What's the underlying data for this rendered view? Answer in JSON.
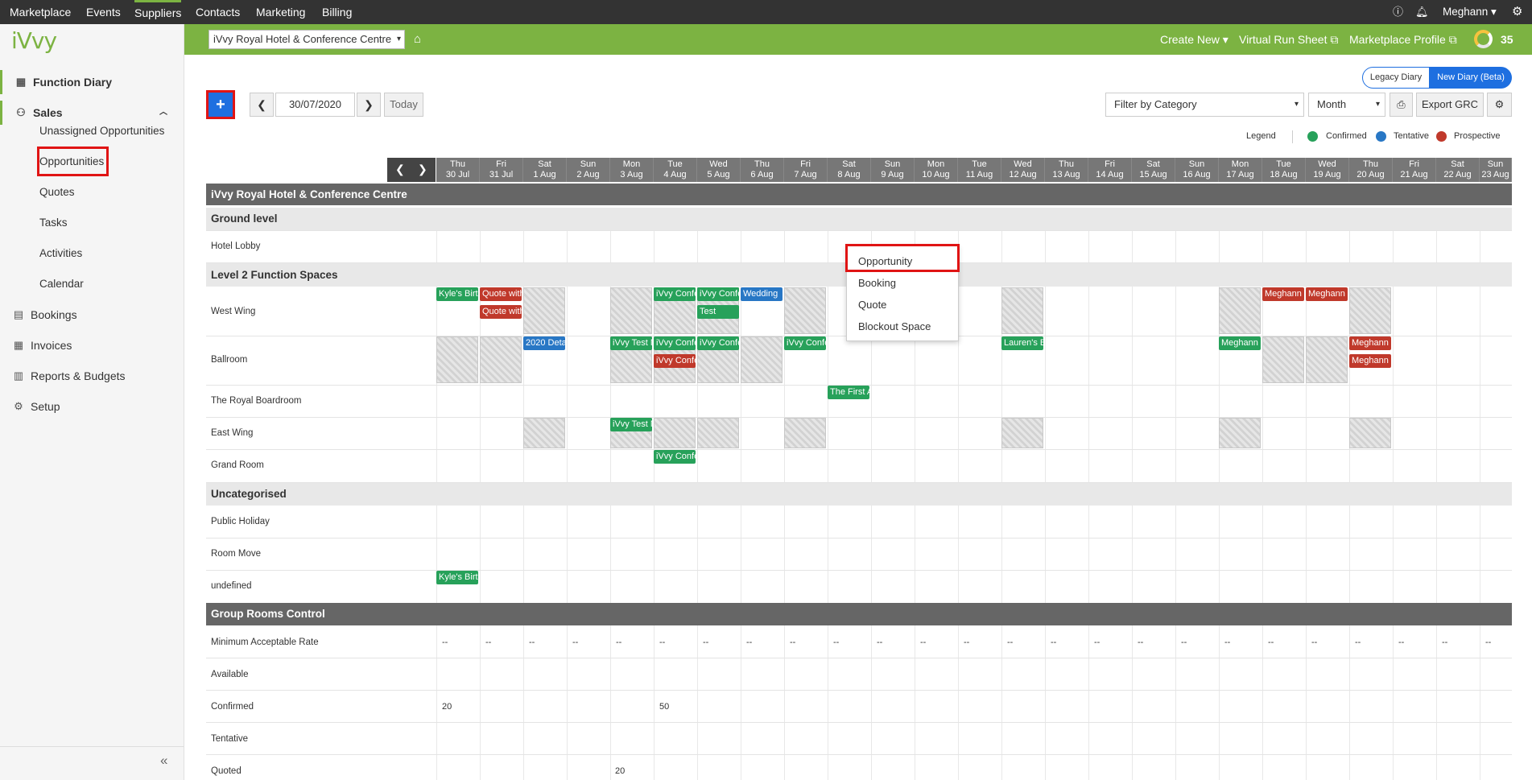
{
  "topnav": {
    "items": [
      "Marketplace",
      "Events",
      "Suppliers",
      "Contacts",
      "Marketing",
      "Billing"
    ],
    "user": "Meghann"
  },
  "sidebar": {
    "logo": "iVvy",
    "function_diary": "Function Diary",
    "sales": "Sales",
    "sales_items": [
      "Unassigned Opportunities",
      "Opportunities",
      "Quotes",
      "Tasks",
      "Activities",
      "Calendar"
    ],
    "bookings": "Bookings",
    "invoices": "Invoices",
    "reports": "Reports & Budgets",
    "setup": "Setup",
    "collapse": "«"
  },
  "greenbar": {
    "venue": "iVvy Royal Hotel & Conference Centre",
    "create_new": "Create New",
    "virtual_run_sheet": "Virtual Run Sheet",
    "marketplace_profile": "Marketplace Profile",
    "score": "35"
  },
  "toolbar": {
    "add": "+",
    "date": "30/07/2020",
    "today": "Today",
    "legacy_diary": "Legacy Diary",
    "new_diary": "New Diary (Beta)",
    "filter": "Filter by Category",
    "view": "Month",
    "export": "Export GRC"
  },
  "legend": {
    "label": "Legend",
    "confirmed": "Confirmed",
    "tentative": "Tentative",
    "prospective": "Prospective",
    "colors": {
      "confirmed": "#27a15a",
      "tentative": "#2877c5",
      "prospective": "#c0392b"
    }
  },
  "days": [
    {
      "d": "Thu",
      "n": "30 Jul"
    },
    {
      "d": "Fri",
      "n": "31 Jul"
    },
    {
      "d": "Sat",
      "n": "1 Aug"
    },
    {
      "d": "Sun",
      "n": "2 Aug"
    },
    {
      "d": "Mon",
      "n": "3 Aug"
    },
    {
      "d": "Tue",
      "n": "4 Aug"
    },
    {
      "d": "Wed",
      "n": "5 Aug"
    },
    {
      "d": "Thu",
      "n": "6 Aug"
    },
    {
      "d": "Fri",
      "n": "7 Aug"
    },
    {
      "d": "Sat",
      "n": "8 Aug"
    },
    {
      "d": "Sun",
      "n": "9 Aug"
    },
    {
      "d": "Mon",
      "n": "10 Aug"
    },
    {
      "d": "Tue",
      "n": "11 Aug"
    },
    {
      "d": "Wed",
      "n": "12 Aug"
    },
    {
      "d": "Thu",
      "n": "13 Aug"
    },
    {
      "d": "Fri",
      "n": "14 Aug"
    },
    {
      "d": "Sat",
      "n": "15 Aug"
    },
    {
      "d": "Sun",
      "n": "16 Aug"
    },
    {
      "d": "Mon",
      "n": "17 Aug"
    },
    {
      "d": "Tue",
      "n": "18 Aug"
    },
    {
      "d": "Wed",
      "n": "19 Aug"
    },
    {
      "d": "Thu",
      "n": "20 Aug"
    },
    {
      "d": "Fri",
      "n": "21 Aug"
    },
    {
      "d": "Sat",
      "n": "22 Aug"
    },
    {
      "d": "Sun",
      "n": "23 Aug"
    }
  ],
  "sections": {
    "venue": "iVvy Royal Hotel & Conference Centre",
    "ground": "Ground level",
    "level2": "Level 2 Function Spaces",
    "uncategorised": "Uncategorised",
    "grc": "Group Rooms Control"
  },
  "rooms": {
    "hotel_lobby": "Hotel Lobby",
    "west_wing": "West Wing",
    "ballroom": "Ballroom",
    "royal_boardroom": "The Royal Boardroom",
    "east_wing": "East Wing",
    "grand_room": "Grand Room",
    "public_holiday": "Public Holiday",
    "room_move": "Room Move",
    "undefined": "undefined"
  },
  "grc": {
    "min_rate": "Minimum Acceptable Rate",
    "available": "Available",
    "confirmed": "Confirmed",
    "tentative": "Tentative",
    "quoted": "Quoted",
    "dash": "--",
    "confirmed_values": [
      "20",
      "50"
    ],
    "quoted_value": "20"
  },
  "events": [
    "Kyle's Birth",
    "Quote with",
    "Quote with",
    "iVvy Confe",
    "iVvy Confe",
    "Test",
    "Wedding",
    "Meghann",
    "Meghann",
    "2020 Deta",
    "iVvy Test N",
    "iVvy Confe",
    "iVvy Confe",
    "iVvy Confe",
    "iVvy Confe",
    "Lauren's B",
    "Meghann",
    "Meghann",
    "The First A",
    "iVvy Test N",
    "iVvy Confe",
    "Kyle's Birth"
  ],
  "dropdown": [
    "Opportunity",
    "Booking",
    "Quote",
    "Blockout Space"
  ]
}
